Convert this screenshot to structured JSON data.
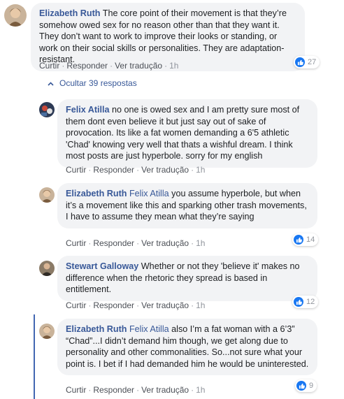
{
  "actions": {
    "like": "Curtir",
    "reply": "Responder",
    "translate": "Ver tradução",
    "sep": "·"
  },
  "hide_replies_label": "Ocultar 39 respostas",
  "comments": [
    {
      "author": "Elizabeth Ruth",
      "mention": "",
      "text": "The core point of their movement is that they’re somehow owed sex for no reason other than that they want it. They don’t want to work to improve their looks or standing, or work on their social skills or personalities. They are adaptation-resistant.",
      "time": "1h",
      "reactions": "27",
      "avatar_color": "#b8956f"
    },
    {
      "author": "Felix Atilla",
      "mention": "",
      "text": "no one is owed sex and I am pretty sure most of them dont even believe it but just say out of sake of provocation. Its like a fat women demanding a 6'5 athletic 'Chad' knowing very well that thats a wishful dream. I think most posts are just hyperbole. sorry for my english",
      "time": "1h",
      "reactions": "",
      "avatar_color": "#3b4a6b"
    },
    {
      "author": "Elizabeth Ruth",
      "mention": "Felix Atilla",
      "text": "you assume hyperbole, but when it’s a movement like this and sparking other trash movements, I have to assume they mean what they’re saying",
      "time": "1h",
      "reactions": "14",
      "avatar_color": "#b8956f"
    },
    {
      "author": "Stewart Galloway",
      "mention": "",
      "text": "Whether or not they 'believe it' makes no difference when the rhetoric they spread is based in entitlement.",
      "time": "1h",
      "reactions": "12",
      "avatar_color": "#6b5a48"
    },
    {
      "author": "Elizabeth Ruth",
      "mention": "Felix Atilla",
      "text": "also I’m a fat woman with a 6’3” “Chad”...I didn’t demand him though, we get along due to personality and other commonalities. So...not sure what your point is. I bet if I had demanded him he would be uninterested.",
      "time": "1h",
      "reactions": "9",
      "avatar_color": "#b8956f"
    }
  ]
}
